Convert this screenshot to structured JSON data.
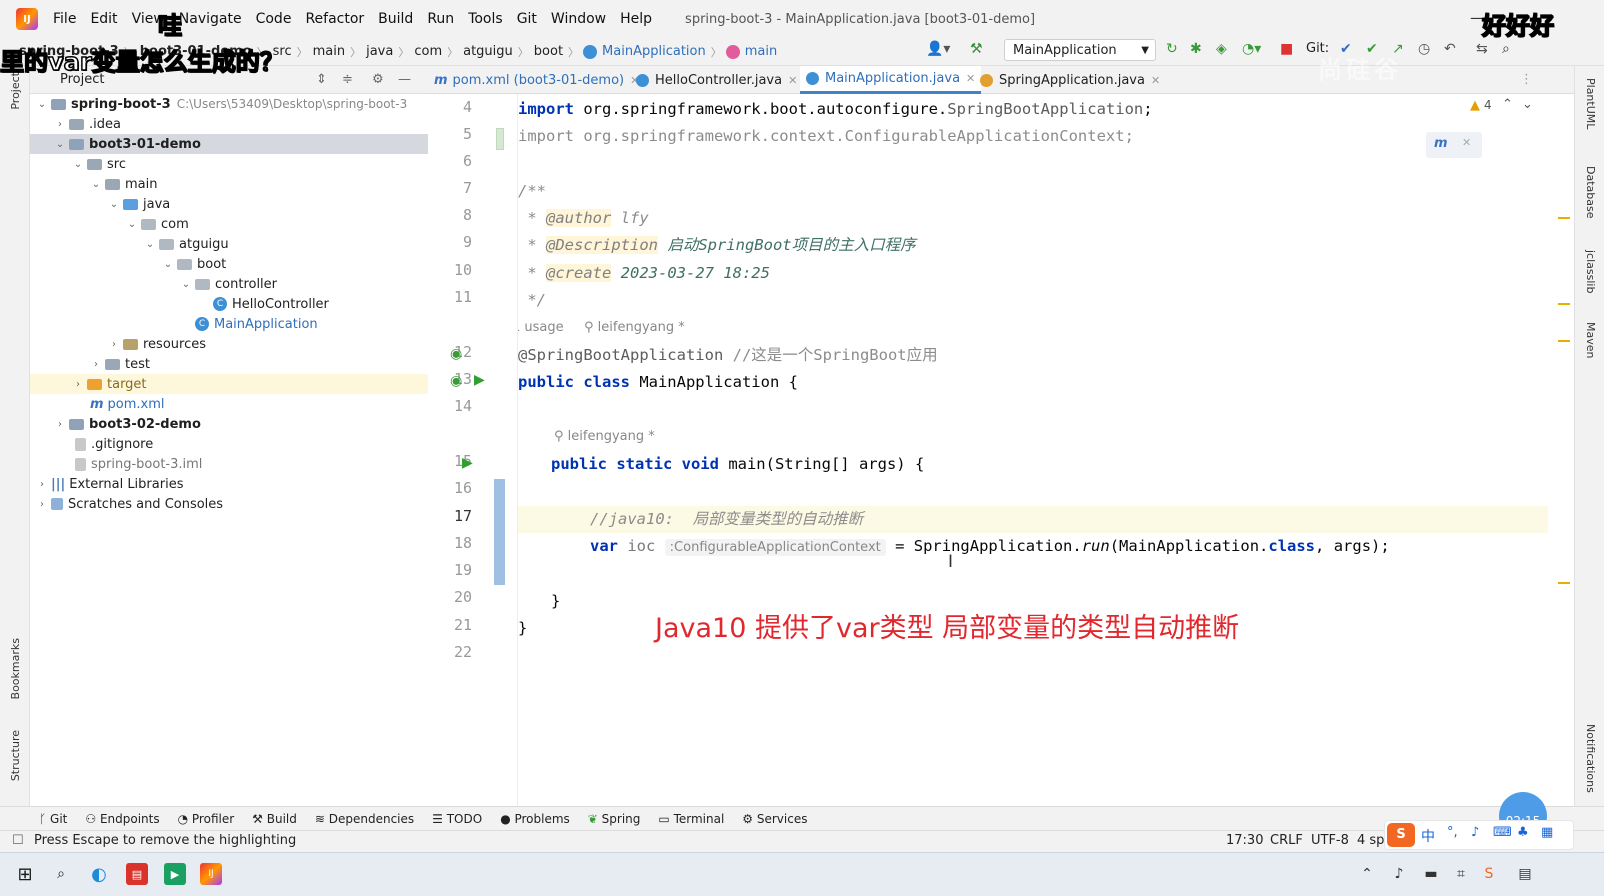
{
  "menubar": {
    "items": [
      "File",
      "Edit",
      "View",
      "Navigate",
      "Code",
      "Refactor",
      "Build",
      "Run",
      "Tools",
      "Git",
      "Window",
      "Help"
    ],
    "title": "spring-boot-3 - MainApplication.java [boot3-01-demo]"
  },
  "breadcrumb": [
    "spring-boot-3",
    "boot3-01-demo",
    "src",
    "main",
    "java",
    "com",
    "atguigu",
    "boot",
    "MainApplication",
    "main"
  ],
  "toolbar": {
    "run_config": "MainApplication",
    "git_label": "Git:"
  },
  "project_panel": {
    "title": "Project"
  },
  "tree": [
    {
      "label": "spring-boot-3",
      "hint": "C:\\Users\\53409\\Desktop\\spring-boot-3"
    },
    {
      "label": ".idea"
    },
    {
      "label": "boot3-01-demo"
    },
    {
      "label": "src"
    },
    {
      "label": "main"
    },
    {
      "label": "java"
    },
    {
      "label": "com"
    },
    {
      "label": "atguigu"
    },
    {
      "label": "boot"
    },
    {
      "label": "controller"
    },
    {
      "label": "HelloController"
    },
    {
      "label": "MainApplication"
    },
    {
      "label": "resources"
    },
    {
      "label": "test"
    },
    {
      "label": "target"
    },
    {
      "label": "pom.xml"
    },
    {
      "label": "boot3-02-demo"
    },
    {
      "label": ".gitignore"
    },
    {
      "label": "spring-boot-3.iml"
    },
    {
      "label": "External Libraries"
    },
    {
      "label": "Scratches and Consoles"
    }
  ],
  "tabs": [
    {
      "label": "pom.xml (boot3-01-demo)"
    },
    {
      "label": "HelloController.java"
    },
    {
      "label": "MainApplication.java"
    },
    {
      "label": "SpringApplication.java"
    }
  ],
  "editor": {
    "warnings": "4",
    "line_numbers": [
      "4",
      "5",
      "6",
      "7",
      "8",
      "9",
      "10",
      "11",
      "12",
      "13",
      "14",
      "15",
      "16",
      "17",
      "18",
      "19",
      "20",
      "21",
      "22"
    ],
    "l4_a": "import ",
    "l4_b": "org.springframework.boot.autoconfigure.",
    "l4_c": "SpringBootApplication",
    "l4_d": ";",
    "l5_a": "import ",
    "l5_b": "org.springframework.context.ConfigurableApplicationContext;",
    "l7": "/**",
    "l8_a": " * ",
    "l8_tag": "@author",
    "l8_val": " lfy",
    "l9_a": " * ",
    "l9_tag": "@Description",
    "l9_val": " 启动SpringBoot项目的主入口程序",
    "l10_a": " * ",
    "l10_tag": "@create",
    "l10_val": " 2023-03-27 18:25",
    "l11": " */",
    "usage": "1 usage",
    "author1": "leifengyang *",
    "l12_a": "@SpringBootApplication",
    "l12_b": " //这是一个SpringBoot应用",
    "l13_a": "public class",
    "l13_b": " MainApplication {",
    "author2": "leifengyang *",
    "l15_a": "public static void",
    "l15_b": " main(String[] args) {",
    "l17": "//java10:  局部变量类型的自动推断",
    "l18_a": "var",
    "l18_b": " ioc ",
    "l18_hint": ":ConfigurableApplicationContext",
    "l18_c": " = SpringApplication.",
    "l18_run": "run",
    "l18_d": "(MainApplication.",
    "l18_e": "class",
    "l18_f": ", args);",
    "l20": "}",
    "l21": "}",
    "annotation": "Java10 提供了var类型 局部变量的类型自动推断"
  },
  "right_tools": [
    "PlantUML",
    "Database",
    "jclasslib",
    "Maven",
    "Notifications"
  ],
  "left_tools": [
    "Project",
    "Bookmarks",
    "Structure"
  ],
  "bottom_tools": [
    "Git",
    "Endpoints",
    "Profiler",
    "Build",
    "Dependencies",
    "TODO",
    "Problems",
    "Spring",
    "Terminal",
    "Services"
  ],
  "status": {
    "message": "Press Escape to remove the highlighting",
    "position": "17:30",
    "line_sep": "CRLF",
    "encoding": "UTF-8",
    "indent": "4 spa",
    "timer": "02:15"
  },
  "overlays": {
    "comment1": "哇",
    "comment2": "里的var变量怎么生成的？",
    "comment3": "好好好",
    "watermark": "尚硅谷"
  },
  "colors": {
    "accent": "#4083c9",
    "annotation_red": "#e0282e",
    "keyword": "#0033b3"
  }
}
